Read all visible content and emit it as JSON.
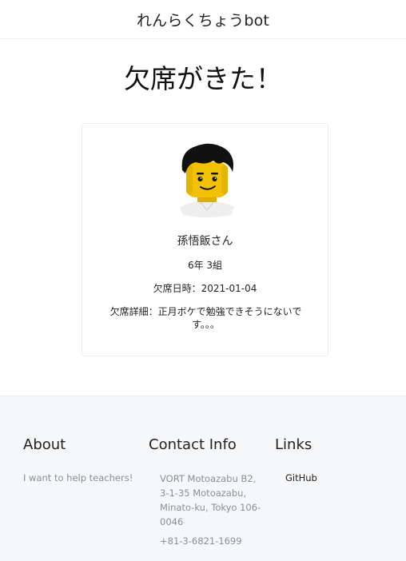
{
  "header": {
    "brand": "れんらくちょうbot"
  },
  "main": {
    "title": "欠席がきた！",
    "card": {
      "avatar_icon": "lego-minifigure-avatar",
      "name": "孫悟飯さん",
      "class": "6年 3組",
      "date": "欠席日時：2021-01-04",
      "detail": "欠席詳細：正月ボケで勉強できそうにないです。。。"
    }
  },
  "footer": {
    "about": {
      "title": "About",
      "text": "I want to help teachers!"
    },
    "contact": {
      "title": "Contact Info",
      "address": "VORT Motoazabu B2, 3-1-35 Motoazabu, Minato-ku, Tokyo 106-0046",
      "phone": "+81-3-6821-1699"
    },
    "links": {
      "title": "Links",
      "github": "GitHub"
    }
  },
  "colors": {
    "footer_bg": "#f6f7f9",
    "muted_text": "#8a8f96",
    "avatar_skin": "#f2c200",
    "avatar_hair": "#111111"
  }
}
